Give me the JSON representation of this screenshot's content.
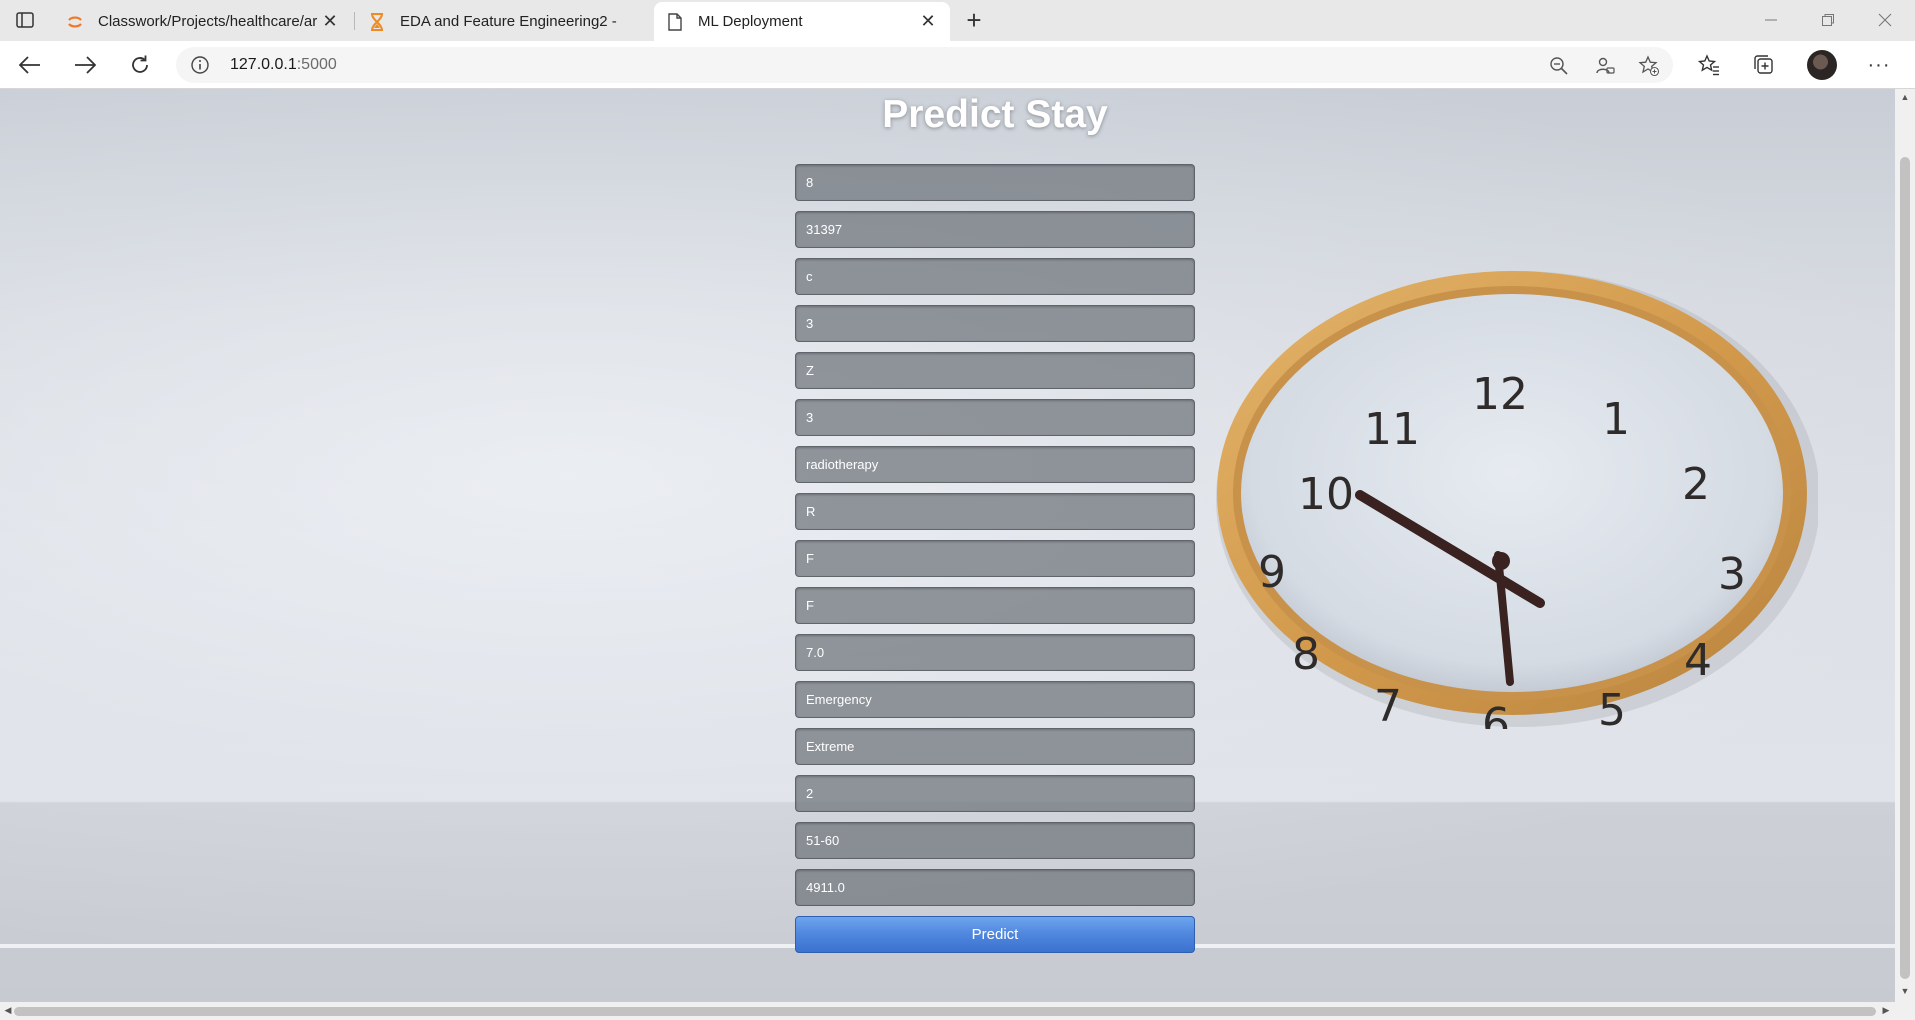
{
  "browser": {
    "tabs": [
      {
        "title": "Classwork/Projects/healthcare/ar",
        "favicon": "jupyter-icon",
        "active": false
      },
      {
        "title": "EDA and Feature Engineering2 -",
        "favicon": "hourglass-icon",
        "active": false
      },
      {
        "title": "ML Deployment",
        "favicon": "page-icon",
        "active": true
      }
    ],
    "close_glyph": "✕",
    "new_tab_glyph": "+",
    "address": {
      "host": "127.0.0.1",
      "port": ":5000"
    },
    "more_glyph": "···"
  },
  "page": {
    "title": "Predict Stay",
    "fields": [
      {
        "value": "8"
      },
      {
        "value": "31397"
      },
      {
        "value": "c"
      },
      {
        "value": "3"
      },
      {
        "value": "Z"
      },
      {
        "value": "3"
      },
      {
        "value": "radiotherapy"
      },
      {
        "value": "R"
      },
      {
        "value": "F"
      },
      {
        "value": "F"
      },
      {
        "value": "7.0"
      },
      {
        "value": "Emergency"
      },
      {
        "value": "Extreme"
      },
      {
        "value": "2"
      },
      {
        "value": "51-60"
      },
      {
        "value": "4911.0"
      }
    ],
    "predict_label": "Predict",
    "clock_numerals": [
      "12",
      "1",
      "2",
      "3",
      "4",
      "5",
      "6",
      "7",
      "8",
      "9",
      "10",
      "11"
    ]
  },
  "colors": {
    "button_blue": "#4f86de",
    "field_gray": "#6e737a",
    "clock_rim": "#d9a35a"
  }
}
